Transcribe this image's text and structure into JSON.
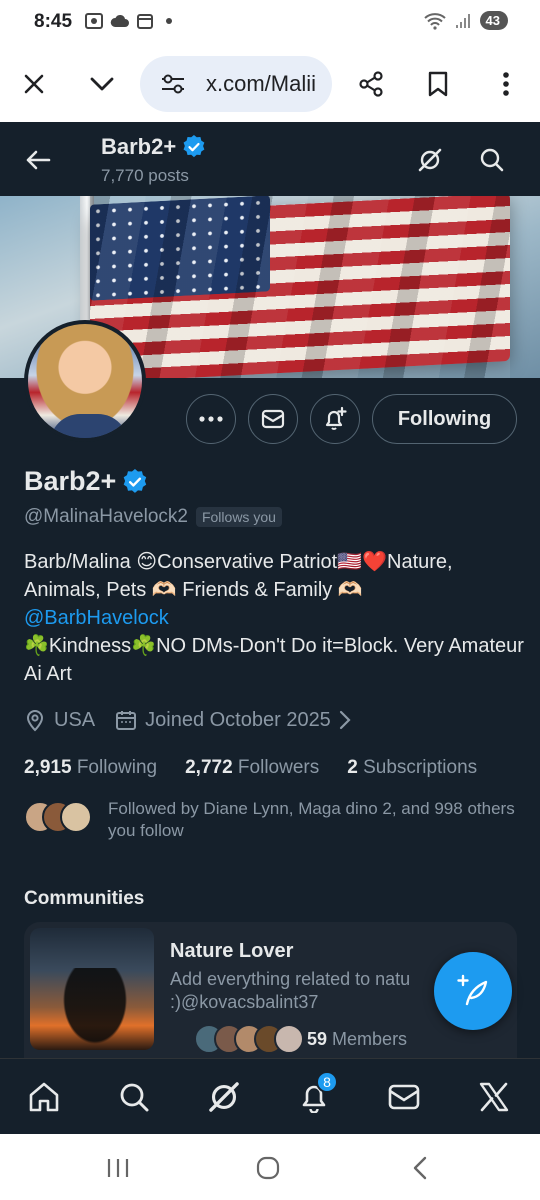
{
  "status": {
    "time": "8:45",
    "battery": "43"
  },
  "browser": {
    "url": "x.com/Malii"
  },
  "header": {
    "name": "Barb2+",
    "posts": "7,770 posts"
  },
  "profile": {
    "name": "Barb2+",
    "handle": "@MalinaHavelock2",
    "follows_you": "Follows you",
    "bio_line1": "Barb/Malina 😊Conservative Patriot🇺🇸❤️Nature, Animals, Pets 🫶🏻 Friends & Family 🫶🏻",
    "bio_mention": "@BarbHavelock",
    "bio_line2": "☘️Kindness☘️NO DMs-Don't Do it=Block. Very Amateur Ai Art",
    "location": "USA",
    "joined": "Joined October 2025",
    "following_button": "Following"
  },
  "stats": {
    "following_count": "2,915",
    "following_label": "Following",
    "followers_count": "2,772",
    "followers_label": "Followers",
    "subscriptions_count": "2",
    "subscriptions_label": "Subscriptions"
  },
  "followed_by": "Followed by Diane Lynn, Maga dino 2, and 998 others you follow",
  "communities": {
    "heading": "Communities",
    "items": [
      {
        "title": "Nature Lover",
        "description_line1": "Add everything related to natu",
        "description_line2": ":)@kovacsbalint37",
        "members_count": "59",
        "members_label": "Members"
      }
    ]
  },
  "bottom_nav": {
    "notifications_badge": "8"
  },
  "colors": {
    "background": "#15202b",
    "accent": "#1d9bf0",
    "muted": "#8b98a5",
    "text": "#e7e9ea"
  }
}
